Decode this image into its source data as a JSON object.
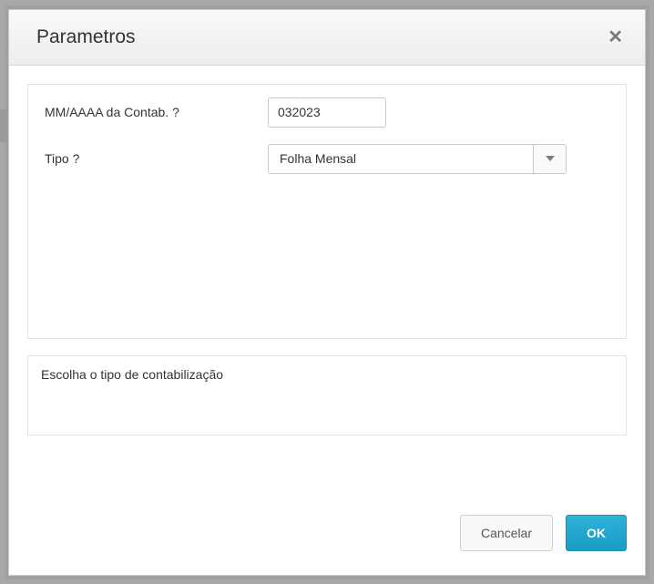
{
  "dialog": {
    "title": "Parametros"
  },
  "form": {
    "date": {
      "label": "MM/AAAA da Contab. ?",
      "value": "032023"
    },
    "type": {
      "label": "Tipo ?",
      "selected": "Folha Mensal"
    }
  },
  "help": {
    "text": "Escolha o tipo de contabilização"
  },
  "footer": {
    "cancel": "Cancelar",
    "ok": "OK"
  }
}
